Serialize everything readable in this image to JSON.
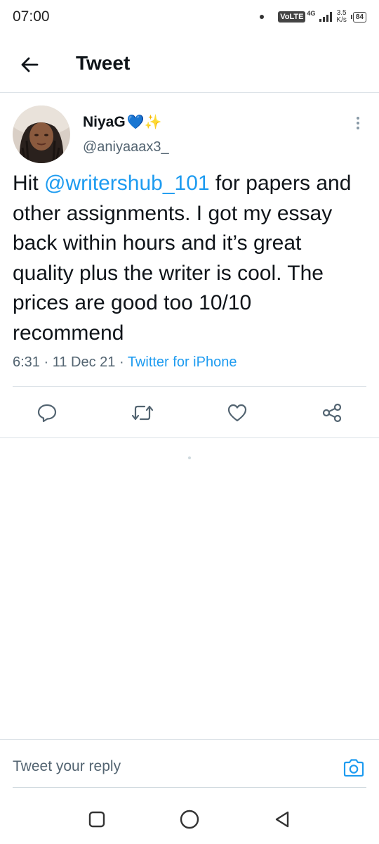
{
  "status_bar": {
    "time": "07:00",
    "network_badge": "VoLTE",
    "network_type": "4G",
    "speed_value": "3.5",
    "speed_unit": "K/s",
    "battery": "84"
  },
  "header": {
    "back_icon": "arrow-left-icon",
    "title": "Tweet"
  },
  "tweet": {
    "author_name": "NiyaG",
    "author_emoji": "💙✨",
    "author_handle": "@aniyaaax3_",
    "text_prefix": "Hit ",
    "mention": "@writershub_101",
    "text_suffix": " for papers and other assignments. I got my essay back within hours and it’s great quality plus the writer is cool. The prices are good too 10/10 recommend",
    "timestamp": "6:31 · 11 Dec 21 · ",
    "source": "Twitter for iPhone"
  },
  "actions": [
    {
      "icon": "reply-icon"
    },
    {
      "icon": "retweet-icon"
    },
    {
      "icon": "like-icon"
    },
    {
      "icon": "share-icon"
    }
  ],
  "reply": {
    "placeholder": "Tweet your reply",
    "camera_icon": "camera-icon"
  },
  "navigation": [
    {
      "icon": "recents-icon"
    },
    {
      "icon": "home-icon"
    },
    {
      "icon": "back-icon"
    }
  ],
  "colors": {
    "accent": "#1d9bf0",
    "text_primary": "#0f1419",
    "text_secondary": "#536471",
    "divider": "#dde3e8"
  }
}
